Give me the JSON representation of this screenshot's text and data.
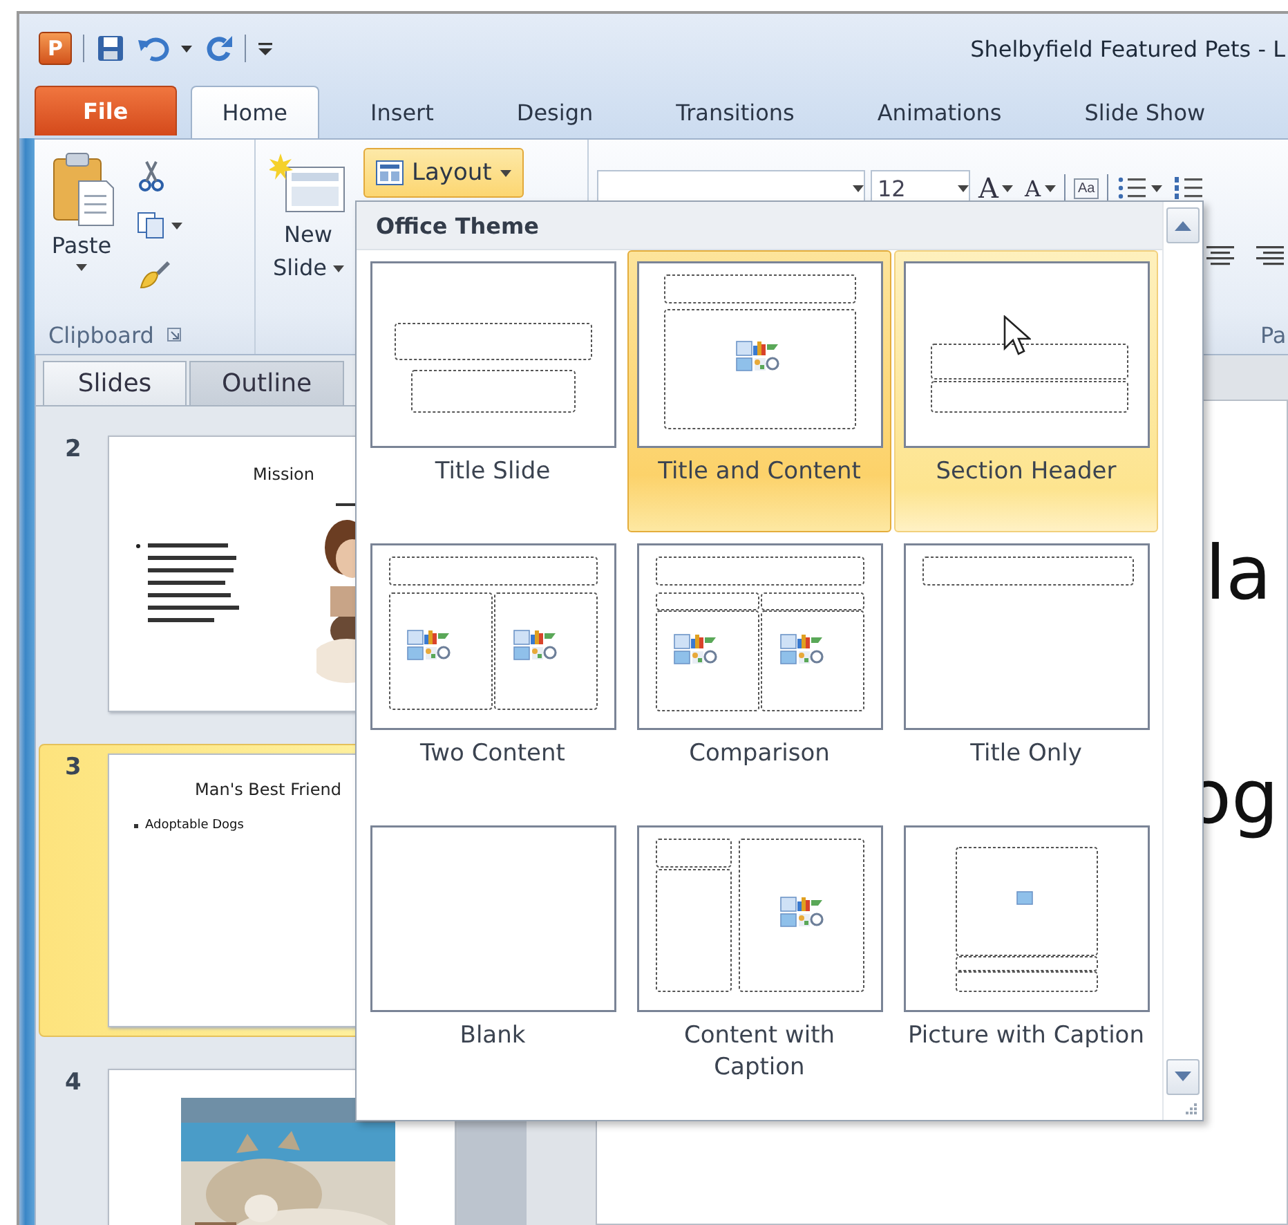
{
  "window": {
    "app_icon": "P",
    "title": "Shelbyfield Featured Pets - L"
  },
  "ribbon_tabs": [
    {
      "label": "File",
      "kind": "file",
      "selected": false
    },
    {
      "label": "Home",
      "kind": "tab",
      "selected": true
    },
    {
      "label": "Insert",
      "kind": "tab",
      "selected": false
    },
    {
      "label": "Design",
      "kind": "tab",
      "selected": false
    },
    {
      "label": "Transitions",
      "kind": "tab",
      "selected": false
    },
    {
      "label": "Animations",
      "kind": "tab",
      "selected": false
    },
    {
      "label": "Slide Show",
      "kind": "tab",
      "selected": false
    }
  ],
  "clipboard_group": {
    "paste": "Paste",
    "label": "Clipboard"
  },
  "slides_group": {
    "new_slide": [
      "New",
      "Slide"
    ],
    "layout_button": {
      "label": "Layout",
      "open": true
    }
  },
  "font_group": {
    "font_size": "12",
    "grow_font": "A",
    "shrink_font": "A",
    "clear_formatting": "Aa"
  },
  "paragraph_group": {
    "label": "Pa"
  },
  "pane_tabs": [
    {
      "label": "Slides",
      "selected": true
    },
    {
      "label": "Outline",
      "selected": false
    }
  ],
  "slides": [
    {
      "number": "2",
      "kind": "title-text-picture",
      "title": "Mission",
      "selected": false
    },
    {
      "number": "3",
      "kind": "title-bullets",
      "title": "Man's Best Friend",
      "bullets": [
        "Adoptable  Dogs"
      ],
      "selected": true
    },
    {
      "number": "4",
      "kind": "picture",
      "selected": false
    }
  ],
  "slide_view": {
    "lines": [
      "la",
      "og"
    ]
  },
  "layout_gallery": {
    "heading": "Office Theme",
    "layouts": [
      {
        "label": "Title Slide",
        "kind": "title-slide",
        "selected": false,
        "hovered": false
      },
      {
        "label": "Title and Content",
        "kind": "title-content",
        "selected": true,
        "hovered": false
      },
      {
        "label": "Section Header",
        "kind": "section-header",
        "selected": false,
        "hovered": true
      },
      {
        "label": "Two Content",
        "kind": "two-content",
        "selected": false,
        "hovered": false
      },
      {
        "label": "Comparison",
        "kind": "comparison",
        "selected": false,
        "hovered": false
      },
      {
        "label": "Title Only",
        "kind": "title-only",
        "selected": false,
        "hovered": false
      },
      {
        "label": "Blank",
        "kind": "blank",
        "selected": false,
        "hovered": false
      },
      {
        "label": "Content with Caption",
        "kind": "content-caption",
        "selected": false,
        "hovered": false
      },
      {
        "label": "Picture with Caption",
        "kind": "picture-caption",
        "selected": false,
        "hovered": false
      }
    ]
  }
}
